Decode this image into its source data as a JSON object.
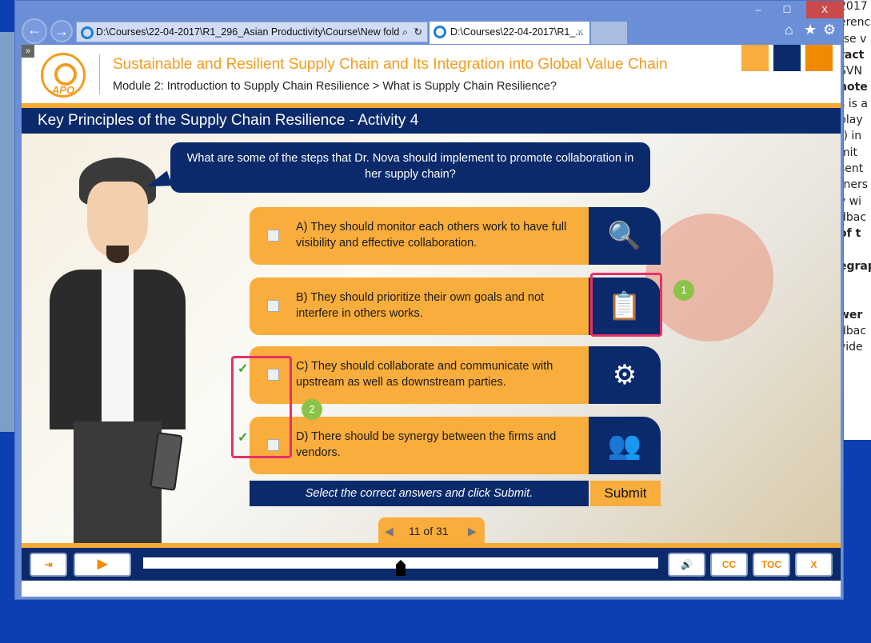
{
  "background_doc": {
    "lines": [
      "2017",
      "erenc",
      "rse v",
      "ract",
      "SVN",
      "note",
      "s is a",
      "play",
      "t) in",
      "mit",
      "sent",
      "rners",
      "y wi",
      "dbac",
      "of t",
      "",
      "egrap",
      "",
      "",
      "wer",
      "dbac",
      "vide"
    ]
  },
  "browser": {
    "address": "D:\\Courses\\22-04-2017\\R1_296_Asian Productivity\\Course\\New fold",
    "tab_title": "D:\\Courses\\22-04-2017\\R1_...",
    "tab_close": "×",
    "minimize": "–",
    "maximize": "☐",
    "close": "X",
    "back": "←",
    "forward": "→",
    "search_icon": "⌕",
    "refresh_icon": "↻",
    "home_icon": "⌂",
    "favorites_icon": "★",
    "settings_icon": "⚙"
  },
  "header": {
    "logo_text": "APO",
    "course_title": "Sustainable and Resilient Supply Chain and Its Integration into Global Value Chain",
    "breadcrumb": "Module 2: Introduction to Supply Chain Resilience > What is Supply Chain Resilience?",
    "expand": "»",
    "accent_colors": [
      "#f9ad3c",
      "#0a2a6b",
      "#f08a00"
    ]
  },
  "slide": {
    "title": "Key Principles of the Supply Chain Resilience - Activity 4",
    "question": "What are some of the steps that Dr. Nova should implement to promote collaboration in her supply chain?",
    "options": [
      {
        "label": "A) They should monitor each others work to have full visibility and effective collaboration.",
        "icon": "magnifier-icon",
        "glyph": "🔍",
        "checked": false
      },
      {
        "label": "B) They should prioritize their own goals and not interfere in others works.",
        "icon": "checklist-icon",
        "glyph": "📋",
        "checked": false
      },
      {
        "label": "C) They should collaborate and communicate with upstream as well as downstream parties.",
        "icon": "gears-icon",
        "glyph": "⚙",
        "checked": false,
        "correct_mark": "✓"
      },
      {
        "label": "D) There should be synergy between the firms and vendors.",
        "icon": "people-icon",
        "glyph": "👥",
        "checked": false,
        "correct_mark": "✓"
      }
    ],
    "instruction": "Select the correct answers and click Submit.",
    "submit": "Submit"
  },
  "annotations": {
    "badge1": "1",
    "badge2": "2"
  },
  "pager": {
    "prev": "◀",
    "label": "11 of 31",
    "next": "▶"
  },
  "controls": {
    "exit": "⇥",
    "play": "▶",
    "volume": "🔊",
    "cc": "CC",
    "toc": "TOC",
    "close": "X",
    "progress": 0.5
  }
}
